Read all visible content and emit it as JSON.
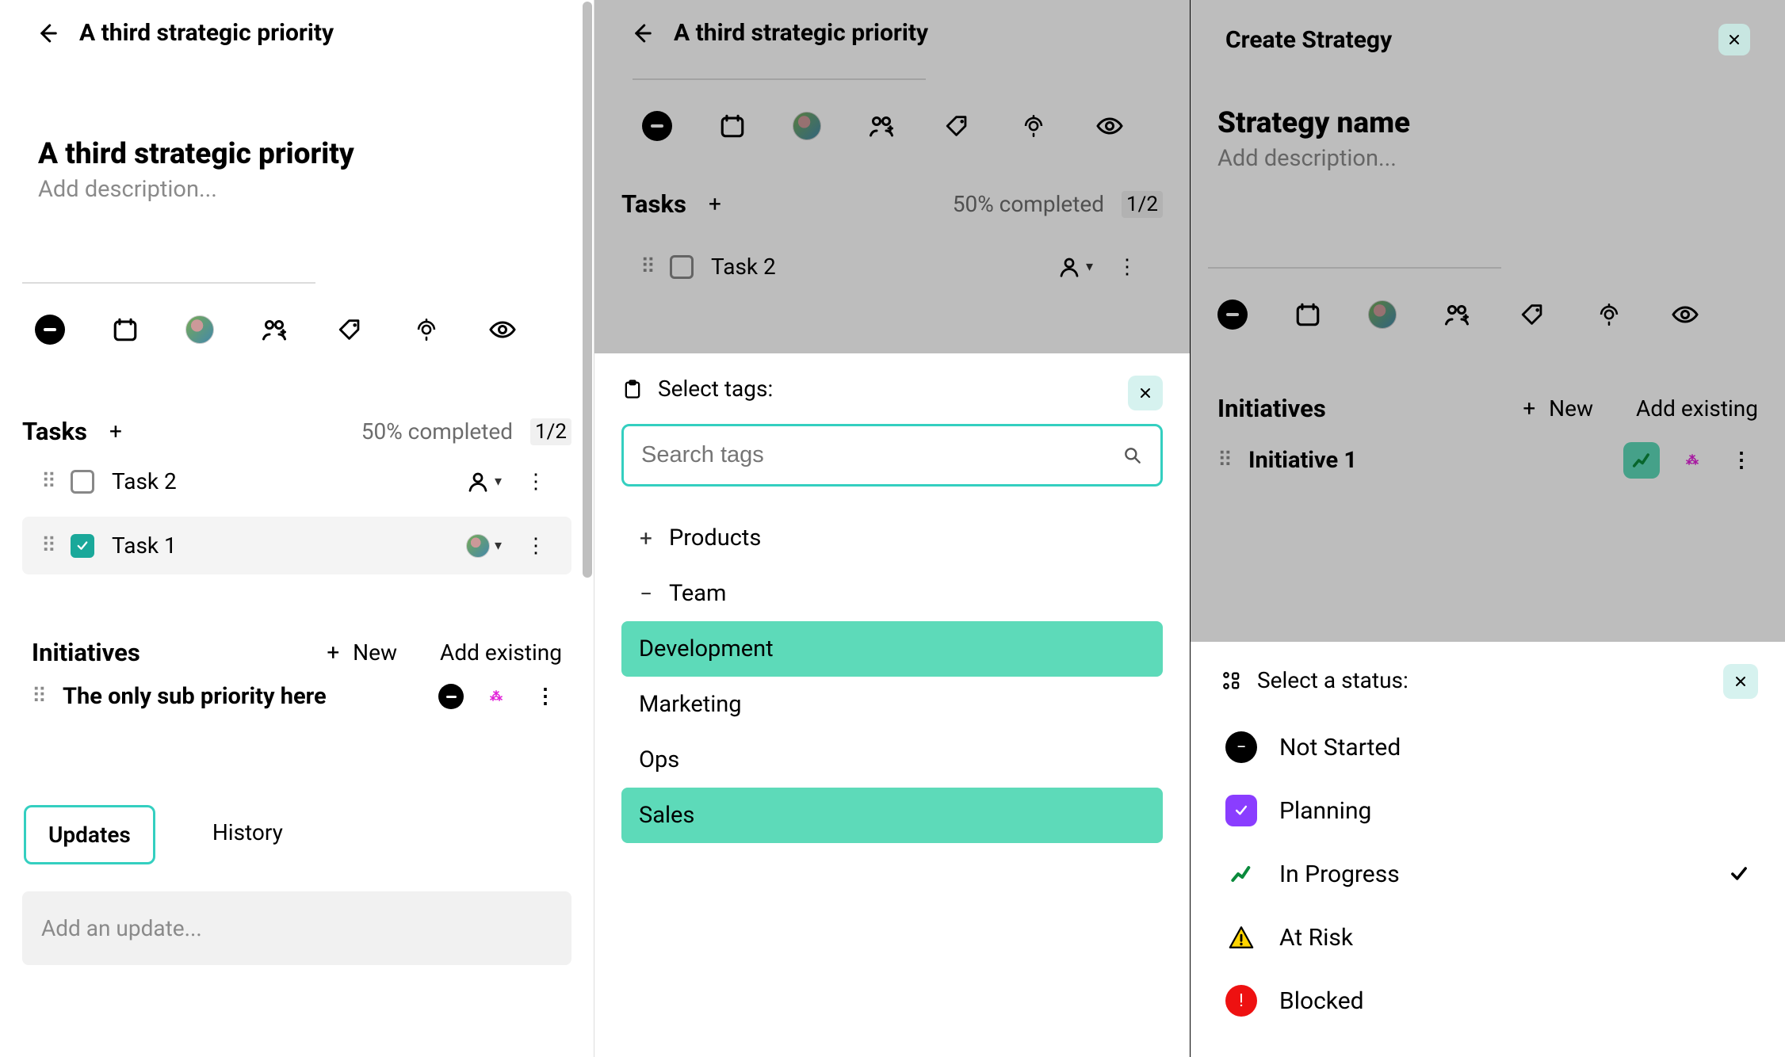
{
  "col1": {
    "header_title": "A third strategic priority",
    "title": "A third strategic priority",
    "description_placeholder": "Add description...",
    "tasks": {
      "label": "Tasks",
      "progress_text": "50% completed",
      "count": "1/2",
      "items": [
        {
          "name": "Task 2",
          "checked": false,
          "assignee": "unassigned"
        },
        {
          "name": "Task 1",
          "checked": true,
          "assignee": "avatar"
        }
      ]
    },
    "initiatives": {
      "label": "Initiatives",
      "new_label": "New",
      "existing_label": "Add existing",
      "items": [
        {
          "name": "The only sub priority here"
        }
      ]
    },
    "tabs": {
      "updates": "Updates",
      "history": "History"
    },
    "update_placeholder": "Add an update..."
  },
  "col2": {
    "header_title": "A third strategic priority",
    "tasks": {
      "label": "Tasks",
      "progress_text": "50% completed",
      "count": "1/2",
      "items": [
        {
          "name": "Task 2",
          "checked": false
        }
      ]
    },
    "tag_popover": {
      "title": "Select tags:",
      "search_placeholder": "Search tags",
      "items": [
        {
          "label": "Products",
          "expand": "+",
          "selected": false
        },
        {
          "label": "Team",
          "expand": "−",
          "selected": false
        },
        {
          "label": "Development",
          "child": true,
          "selected": true
        },
        {
          "label": "Marketing",
          "child": true,
          "selected": false
        },
        {
          "label": "Ops",
          "child": true,
          "selected": false
        },
        {
          "label": "Sales",
          "child": true,
          "selected": true
        }
      ]
    }
  },
  "col3": {
    "header_title": "Create Strategy",
    "title": "Strategy name",
    "description_placeholder": "Add description...",
    "initiatives": {
      "label": "Initiatives",
      "new_label": "New",
      "existing_label": "Add existing",
      "items": [
        {
          "name": "Initiative 1"
        }
      ]
    },
    "status_popover": {
      "title": "Select a status:",
      "items": [
        {
          "label": "Not Started",
          "kind": "notstarted"
        },
        {
          "label": "Planning",
          "kind": "planning"
        },
        {
          "label": "In Progress",
          "kind": "inprog",
          "selected": true
        },
        {
          "label": "At Risk",
          "kind": "risk"
        },
        {
          "label": "Blocked",
          "kind": "blocked"
        }
      ]
    }
  },
  "icons": {
    "calendar": "cal",
    "avatar": "av",
    "team": "team",
    "tag": "tag",
    "bell": "bell",
    "eye": "eye"
  }
}
